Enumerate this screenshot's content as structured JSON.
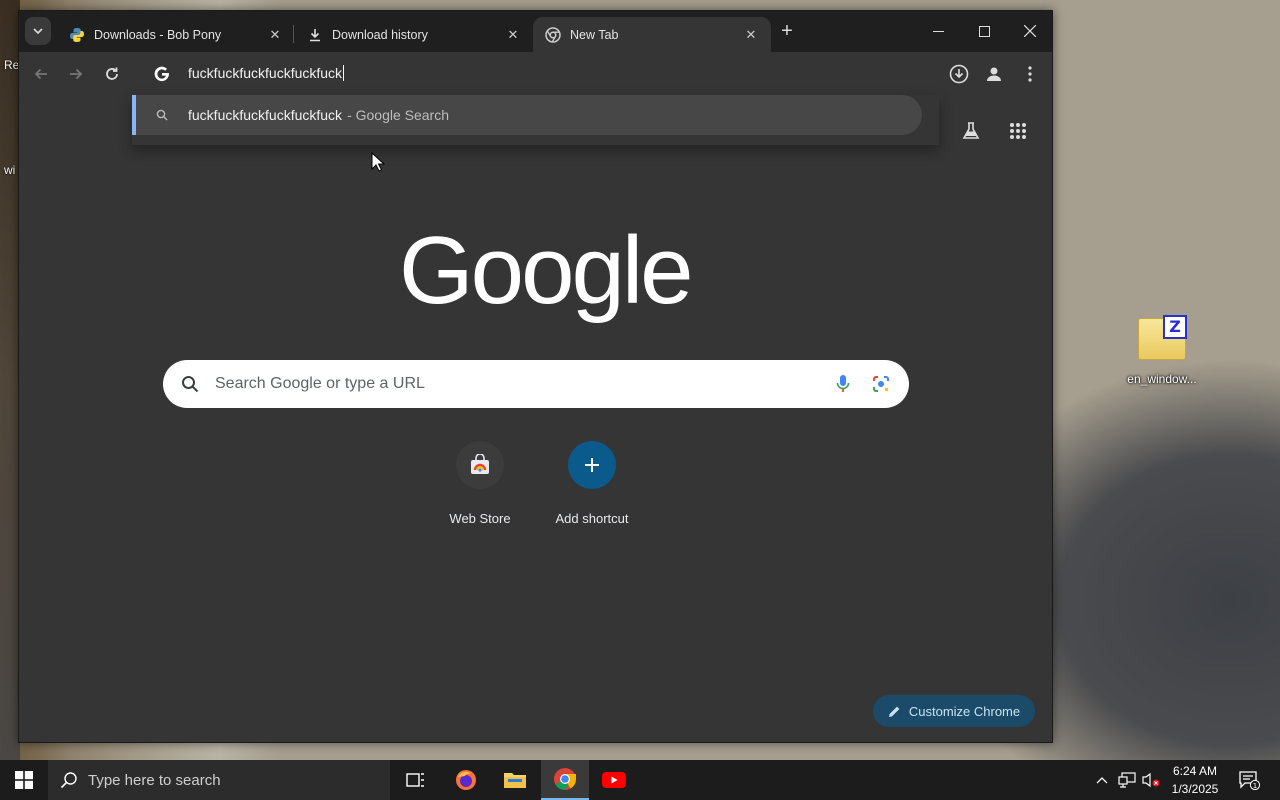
{
  "browser": {
    "tabs": [
      {
        "title": "Downloads - Bob Pony",
        "favicon": "python-icon",
        "active": false
      },
      {
        "title": "Download history",
        "favicon": "download-icon",
        "active": false
      },
      {
        "title": "New Tab",
        "favicon": "chrome-icon",
        "active": true
      }
    ],
    "omnibox": {
      "text": "fuckfuckfuckfuckfuckfuck"
    },
    "suggestion": {
      "query": "fuckfuckfuckfuckfuckfuck",
      "separator_text": "- Google Search"
    }
  },
  "ntp": {
    "logo_text": "Google",
    "search_placeholder": "Search Google or type a URL",
    "shortcuts": [
      {
        "label": "Web Store",
        "icon": "web-store-icon"
      },
      {
        "label": "Add shortcut",
        "icon": "plus-icon"
      }
    ],
    "customize_label": "Customize Chrome"
  },
  "desktop": {
    "icon_label": "en_window...",
    "edge_text_1": "Re",
    "edge_text_2": "wi"
  },
  "taskbar": {
    "search_placeholder": "Type here to search",
    "time": "6:24 AM",
    "date": "1/3/2025",
    "notification_count": "1"
  },
  "colors": {
    "accent_blue": "#8ab4f8",
    "customize_bg": "#1b4b68",
    "add_shortcut_bg": "#0b5a8c"
  }
}
